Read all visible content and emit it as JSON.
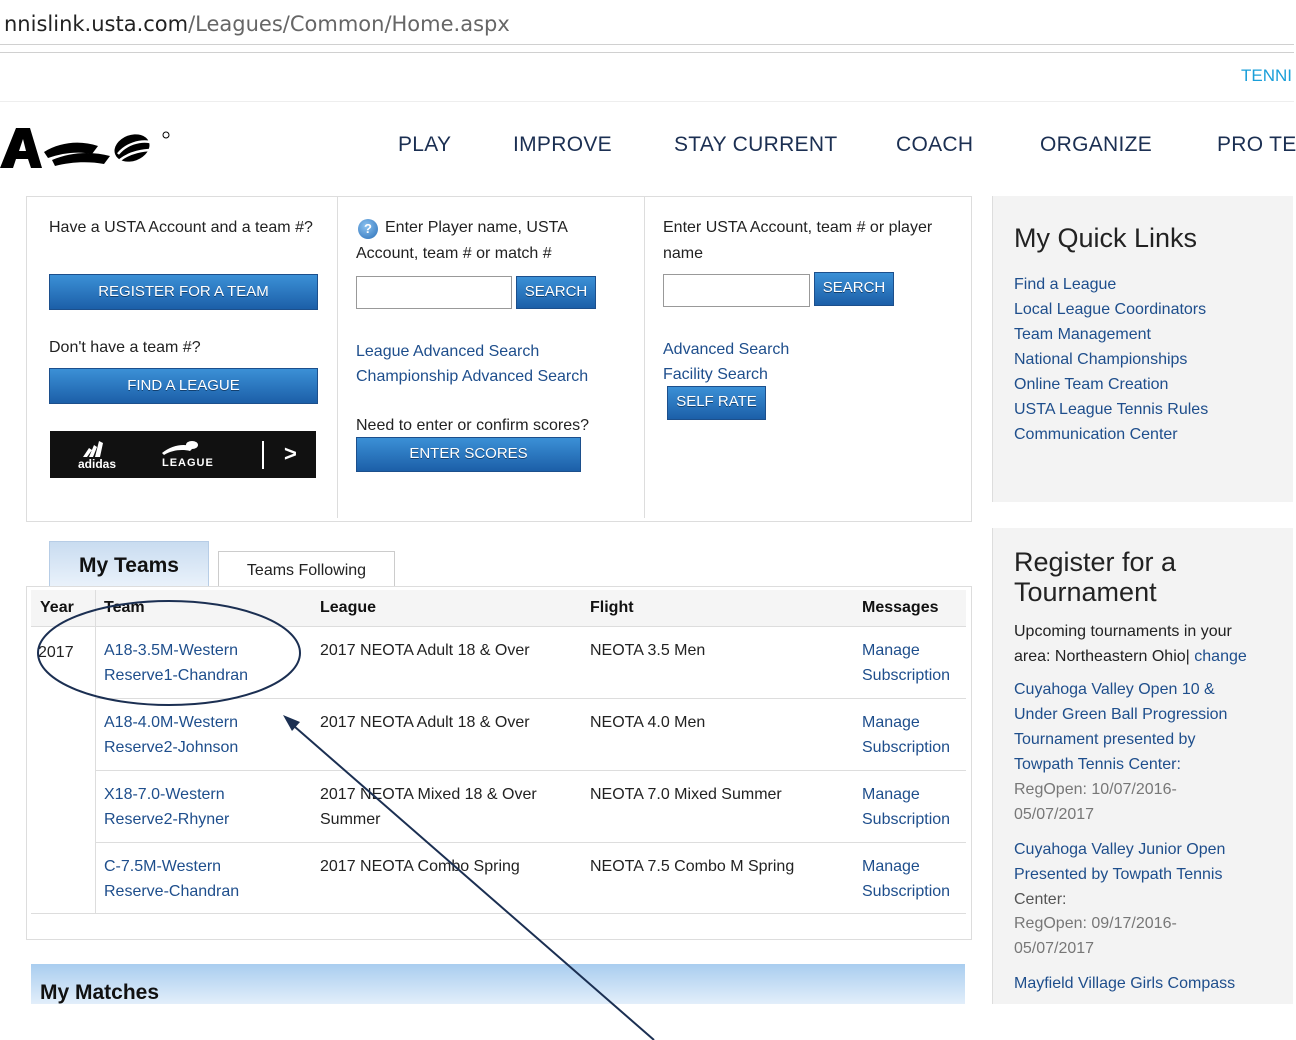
{
  "browser": {
    "url_host": "nnislink.usta.com",
    "url_path": "/Leagues/Common/Home.aspx"
  },
  "header": {
    "top_right_text": "TENNI",
    "nav": [
      "PLAY",
      "IMPROVE",
      "STAY CURRENT",
      "COACH",
      "ORGANIZE",
      "PRO TE"
    ]
  },
  "register_panel": {
    "have_account_text": "Have a USTA Account and a team #?",
    "register_button": "REGISTER FOR A TEAM",
    "no_team_text": "Don't have a team #?",
    "find_league_button": "FIND A LEAGUE",
    "ad_brand": "adidas",
    "ad_league": "LEAGUE",
    "ad_arrow": ">"
  },
  "search_panel": {
    "help_icon": "?",
    "prompt": "Enter Player name, USTA Account, team # or match #",
    "search_button": "SEARCH",
    "links": [
      "League Advanced Search",
      "Championship Advanced Search"
    ],
    "scores_prompt": "Need to enter or confirm scores?",
    "enter_scores_button": "ENTER SCORES"
  },
  "account_panel": {
    "prompt": "Enter USTA Account, team # or player name",
    "search_button": "SEARCH",
    "links": [
      "Advanced Search",
      "Facility Search"
    ],
    "self_rate_button": "SELF RATE"
  },
  "tabs": {
    "my_teams": "My Teams",
    "teams_following": "Teams Following"
  },
  "teams_table": {
    "headers": [
      "Year",
      "Team",
      "League",
      "Flight",
      "Messages"
    ],
    "year": "2017",
    "rows": [
      {
        "team": [
          "A18-3.5M-Western",
          "Reserve1-Chandran"
        ],
        "league": [
          "2017 NEOTA Adult 18 & Over"
        ],
        "flight": "NEOTA 3.5 Men",
        "messages": [
          "Manage",
          "Subscription"
        ]
      },
      {
        "team": [
          "A18-4.0M-Western",
          "Reserve2-Johnson"
        ],
        "league": [
          "2017 NEOTA Adult 18 & Over"
        ],
        "flight": "NEOTA 4.0 Men",
        "messages": [
          "Manage",
          "Subscription"
        ]
      },
      {
        "team": [
          "X18-7.0-Western",
          "Reserve2-Rhyner"
        ],
        "league": [
          "2017 NEOTA Mixed 18 & Over",
          "Summer"
        ],
        "flight": "NEOTA 7.0 Mixed Summer",
        "messages": [
          "Manage",
          "Subscription"
        ]
      },
      {
        "team": [
          "C-7.5M-Western",
          "Reserve-Chandran"
        ],
        "league": [
          "2017 NEOTA Combo Spring"
        ],
        "flight": "NEOTA 7.5 Combo M Spring",
        "messages": [
          "Manage",
          "Subscription"
        ]
      }
    ]
  },
  "my_matches": {
    "title": "My Matches"
  },
  "quick_links": {
    "title": "My Quick Links",
    "links": [
      "Find a League",
      "Local League Coordinators",
      "Team Management",
      "National Championships",
      "Online Team Creation",
      "USTA League Tennis Rules",
      "Communication Center"
    ]
  },
  "tournaments": {
    "title_line1": "Register for a",
    "title_line2": "Tournament",
    "upcoming_line1": "Upcoming tournaments in your",
    "upcoming_line2": "area: Northeastern Ohio|",
    "change_link": "change",
    "t1_lines": [
      "Cuyahoga Valley Open 10 &",
      "Under Green Ball Progression",
      "Tournament presented by",
      "Towpath Tennis Center:"
    ],
    "t1_reg": [
      "RegOpen: 10/07/2016-",
      "05/07/2017"
    ],
    "t2_lines": [
      "Cuyahoga Valley Junior Open",
      "Presented by Towpath Tennis"
    ],
    "t2_center": "Center:",
    "t2_reg": [
      "RegOpen: 09/17/2016-",
      "05/07/2017"
    ],
    "t3_lines": [
      "Mayfield Village Girls Compass"
    ]
  },
  "colors": {
    "link": "#1e4e8c",
    "button_blue": "#1c5fa8",
    "nav_text": "#1b2f52",
    "top_link": "#1a9fd9"
  }
}
